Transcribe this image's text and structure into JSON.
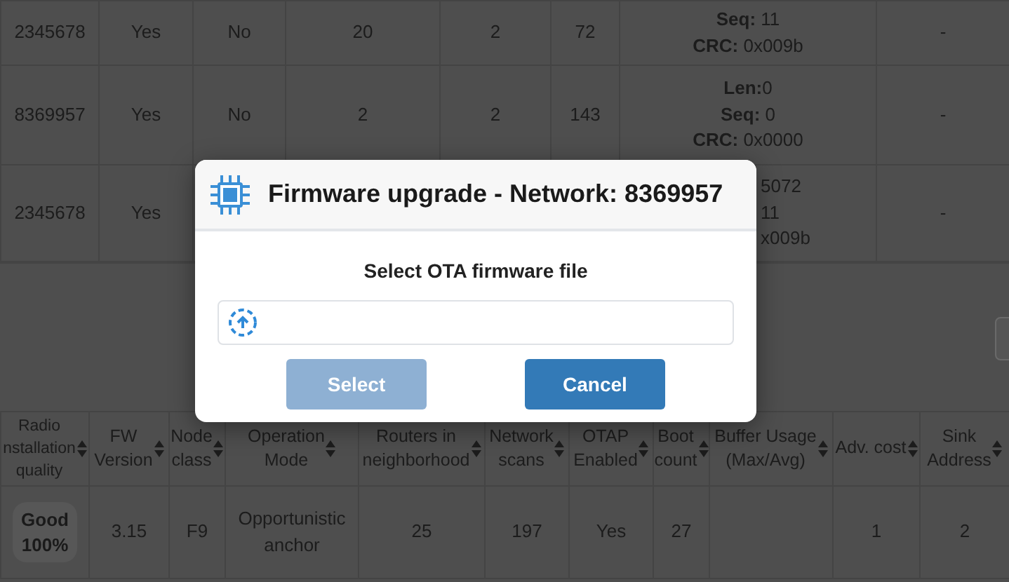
{
  "nodes_table": {
    "rows": [
      {
        "cells": [
          "2345678",
          "Yes",
          "No",
          "20",
          "2",
          "72"
        ],
        "status_lines": [
          "**Seq:** 11",
          "**CRC:** 0x009b"
        ],
        "last": "-"
      },
      {
        "cells": [
          "8369957",
          "Yes",
          "No",
          "2",
          "2",
          "143"
        ],
        "status_lines": [
          "**Len:**0",
          "**Seq:** 0",
          "**CRC:** 0x0000"
        ],
        "last": "-"
      },
      {
        "cells": [
          "2345678",
          "Yes"
        ],
        "status_lines": [
          "5072",
          "11",
          "x009b"
        ],
        "last": "-",
        "covered": true
      }
    ]
  },
  "details_table": {
    "columns": [
      {
        "lines": [
          "Radio",
          "nstallation",
          "quality"
        ]
      },
      {
        "lines": [
          "FW",
          "Version"
        ]
      },
      {
        "lines": [
          "Node",
          "class"
        ]
      },
      {
        "lines": [
          "Operation",
          "Mode"
        ]
      },
      {
        "lines": [
          "Routers in",
          "neighborhood"
        ]
      },
      {
        "lines": [
          "Network",
          "scans"
        ]
      },
      {
        "lines": [
          "OTAP",
          "Enabled"
        ]
      },
      {
        "lines": [
          "Boot",
          "count"
        ]
      },
      {
        "lines": [
          "Buffer Usage",
          "(Max/Avg)"
        ]
      },
      {
        "lines": [
          "Adv. cost"
        ]
      },
      {
        "lines": [
          "Sink",
          "Address"
        ]
      }
    ],
    "rows": [
      {
        "cells": [
          {
            "kind": "badge",
            "lines": [
              "Good",
              "100%"
            ]
          },
          {
            "kind": "text",
            "text": "3.15"
          },
          {
            "kind": "text",
            "text": "F9"
          },
          {
            "kind": "text",
            "text": "Opportunistic anchor"
          },
          {
            "kind": "text",
            "text": "25"
          },
          {
            "kind": "text",
            "text": "197"
          },
          {
            "kind": "text",
            "text": "Yes"
          },
          {
            "kind": "text",
            "text": "27"
          },
          {
            "kind": "text",
            "text": ""
          },
          {
            "kind": "text",
            "text": "1"
          },
          {
            "kind": "text",
            "text": "2"
          }
        ]
      }
    ]
  },
  "modal": {
    "title": "Firmware upgrade - Network: 8369957",
    "prompt": "Select OTA firmware file",
    "buttons": [
      {
        "label": "Select",
        "disabled": true
      },
      {
        "label": "Cancel",
        "disabled": false
      }
    ]
  }
}
